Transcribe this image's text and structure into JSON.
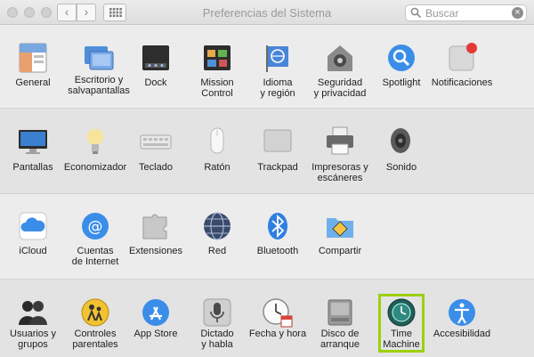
{
  "window": {
    "title": "Preferencias del Sistema"
  },
  "toolbar": {
    "back_label": "‹",
    "forward_label": "›"
  },
  "search": {
    "placeholder": "Buscar",
    "value": "",
    "clear_label": "×"
  },
  "rows": [
    {
      "panes": [
        {
          "label": "General",
          "icon": "general-icon"
        },
        {
          "label": "Escritorio y\nsalvapantallas",
          "icon": "desktop-screensaver-icon"
        },
        {
          "label": "Dock",
          "icon": "dock-icon"
        },
        {
          "label": "Mission\nControl",
          "icon": "mission-control-icon"
        },
        {
          "label": "Idioma\ny región",
          "icon": "language-region-icon"
        },
        {
          "label": "Seguridad\ny privacidad",
          "icon": "security-privacy-icon"
        },
        {
          "label": "Spotlight",
          "icon": "spotlight-icon"
        },
        {
          "label": "Notificaciones",
          "icon": "notifications-icon"
        }
      ]
    },
    {
      "panes": [
        {
          "label": "Pantallas",
          "icon": "displays-icon"
        },
        {
          "label": "Economizador",
          "icon": "energy-saver-icon"
        },
        {
          "label": "Teclado",
          "icon": "keyboard-icon"
        },
        {
          "label": "Ratón",
          "icon": "mouse-icon"
        },
        {
          "label": "Trackpad",
          "icon": "trackpad-icon"
        },
        {
          "label": "Impresoras y\nescáneres",
          "icon": "printers-icon"
        },
        {
          "label": "Sonido",
          "icon": "sound-icon"
        }
      ]
    },
    {
      "panes": [
        {
          "label": "iCloud",
          "icon": "icloud-icon"
        },
        {
          "label": "Cuentas\nde Internet",
          "icon": "internet-accounts-icon"
        },
        {
          "label": "Extensiones",
          "icon": "extensions-icon"
        },
        {
          "label": "Red",
          "icon": "network-icon"
        },
        {
          "label": "Bluetooth",
          "icon": "bluetooth-icon"
        },
        {
          "label": "Compartir",
          "icon": "sharing-icon"
        }
      ]
    },
    {
      "panes": [
        {
          "label": "Usuarios y\ngrupos",
          "icon": "users-groups-icon"
        },
        {
          "label": "Controles\nparentales",
          "icon": "parental-controls-icon"
        },
        {
          "label": "App Store",
          "icon": "app-store-icon"
        },
        {
          "label": "Dictado\ny habla",
          "icon": "dictation-speech-icon"
        },
        {
          "label": "Fecha y hora",
          "icon": "date-time-icon"
        },
        {
          "label": "Disco de\narranque",
          "icon": "startup-disk-icon"
        },
        {
          "label": "Time\nMachine",
          "icon": "time-machine-icon"
        },
        {
          "label": "Accesibilidad",
          "icon": "accessibility-icon"
        }
      ]
    }
  ],
  "colors": {
    "highlight": "#9bd10f",
    "accent": "#3b8ee8"
  }
}
